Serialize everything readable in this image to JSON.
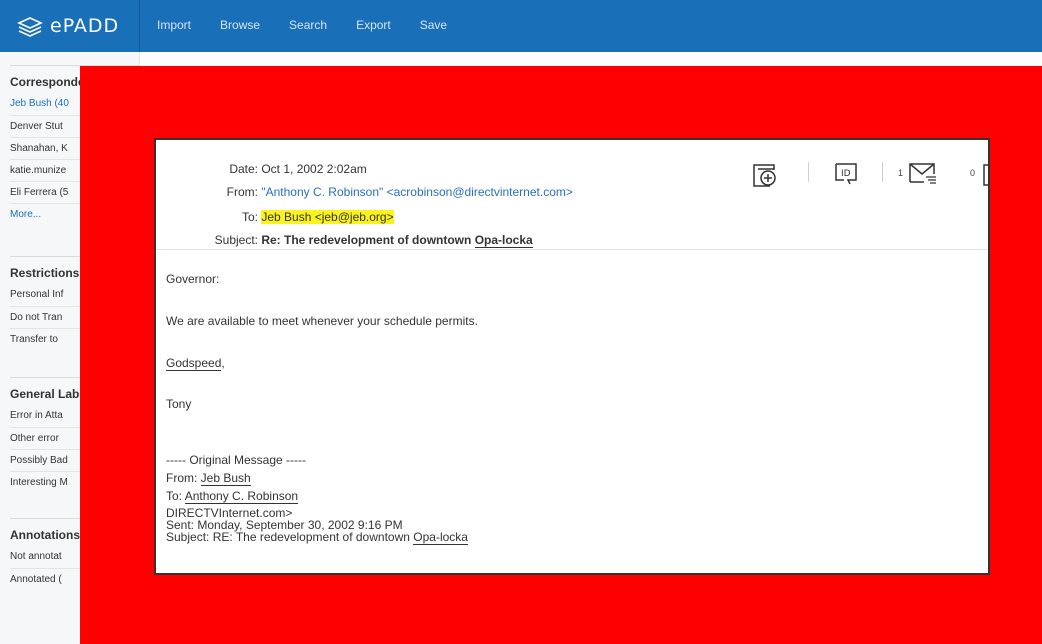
{
  "app": {
    "logo_text": "ePADD"
  },
  "nav": [
    "Import",
    "Browse",
    "Search",
    "Export",
    "Save"
  ],
  "sidebar": {
    "correspondents": {
      "title": "Correspondents",
      "items": [
        "Jeb Bush (40",
        "Denver Stut",
        "Shanahan, K",
        "katie.munize",
        "Eli Ferrera (5",
        "More..."
      ]
    },
    "restrictions": {
      "title": "Restrictions",
      "items": [
        "Personal Inf",
        "Do not Tran",
        "Transfer to "
      ]
    },
    "general": {
      "title": "General Labels",
      "items": [
        "Error in Atta",
        "Other error",
        "Possibly Bad",
        "Interesting M"
      ]
    },
    "annotations": {
      "title": "Annotations",
      "items": [
        "Not annotat",
        "Annotated ("
      ]
    }
  },
  "message": {
    "date_label": "Date:",
    "date": "Oct 1, 2002 2:02am",
    "from_label": "From:",
    "from": "\"Anthony C. Robinson\" <acrobinson@directvinternet.com>",
    "to_label": "To:",
    "to": "Jeb Bush <jeb@jeb.org>",
    "subject_label": "Subject:",
    "subject_prefix": "Re: The redevelopment of downtown ",
    "subject_link": "Opa-locka",
    "body": {
      "greeting": "Governor:",
      "line1": "We are available to meet whenever your schedule permits.",
      "signoff_link": "Godspeed",
      "signoff_tail": ",",
      "name": "Tony"
    },
    "original": {
      "header": "----- Original Message -----",
      "from_label": "From: ",
      "from": "Jeb Bush",
      "to_label": "To: ",
      "to": "Anthony C. Robinson",
      "to_cont": "DIRECTVInternet.com>",
      "sent": "Sent: Monday, September 30, 2002 9:16 PM",
      "subject_prefix": "Subject: RE: The redevelopment of downtown ",
      "subject_link": "Opa-locka"
    },
    "counts": {
      "messages": "1",
      "other": "0"
    },
    "icons": [
      "add-label-icon",
      "id-icon",
      "message-count-icon"
    ]
  },
  "colors": {
    "topbar": "#1a6fb9",
    "overlay": "#ff0000",
    "highlight": "#fbf31c",
    "link": "#2a6ebb"
  }
}
